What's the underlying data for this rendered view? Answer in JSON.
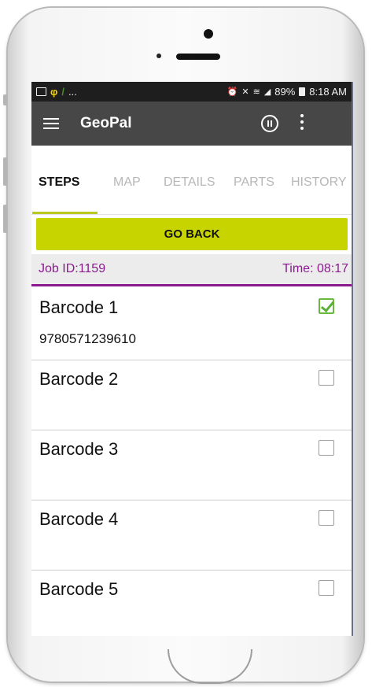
{
  "status_bar": {
    "left_dots": "...",
    "battery_percent": "89%",
    "time": "8:18 AM"
  },
  "app_bar": {
    "title": "GeoPal",
    "icons": [
      "menu-icon",
      "pause-icon",
      "overflow-icon"
    ]
  },
  "tabs": [
    {
      "label": "STEPS",
      "active": true
    },
    {
      "label": "MAP",
      "active": false
    },
    {
      "label": "DETAILS",
      "active": false
    },
    {
      "label": "PARTS",
      "active": false
    },
    {
      "label": "HISTORY",
      "active": false
    }
  ],
  "go_back_label": "GO BACK",
  "job": {
    "id_text": "Job ID:1159",
    "time_text": "Time: 08:17"
  },
  "barcodes": [
    {
      "label": "Barcode 1",
      "value": "9780571239610",
      "checked": true
    },
    {
      "label": "Barcode 2",
      "value": "",
      "checked": false
    },
    {
      "label": "Barcode 3",
      "value": "",
      "checked": false
    },
    {
      "label": "Barcode 4",
      "value": "",
      "checked": false
    },
    {
      "label": "Barcode 5",
      "value": "",
      "checked": false
    }
  ],
  "colors": {
    "accent_button": "#c7d400",
    "job_text": "#8b1a8f",
    "app_bar": "#474747",
    "check_green": "#5fae35"
  }
}
